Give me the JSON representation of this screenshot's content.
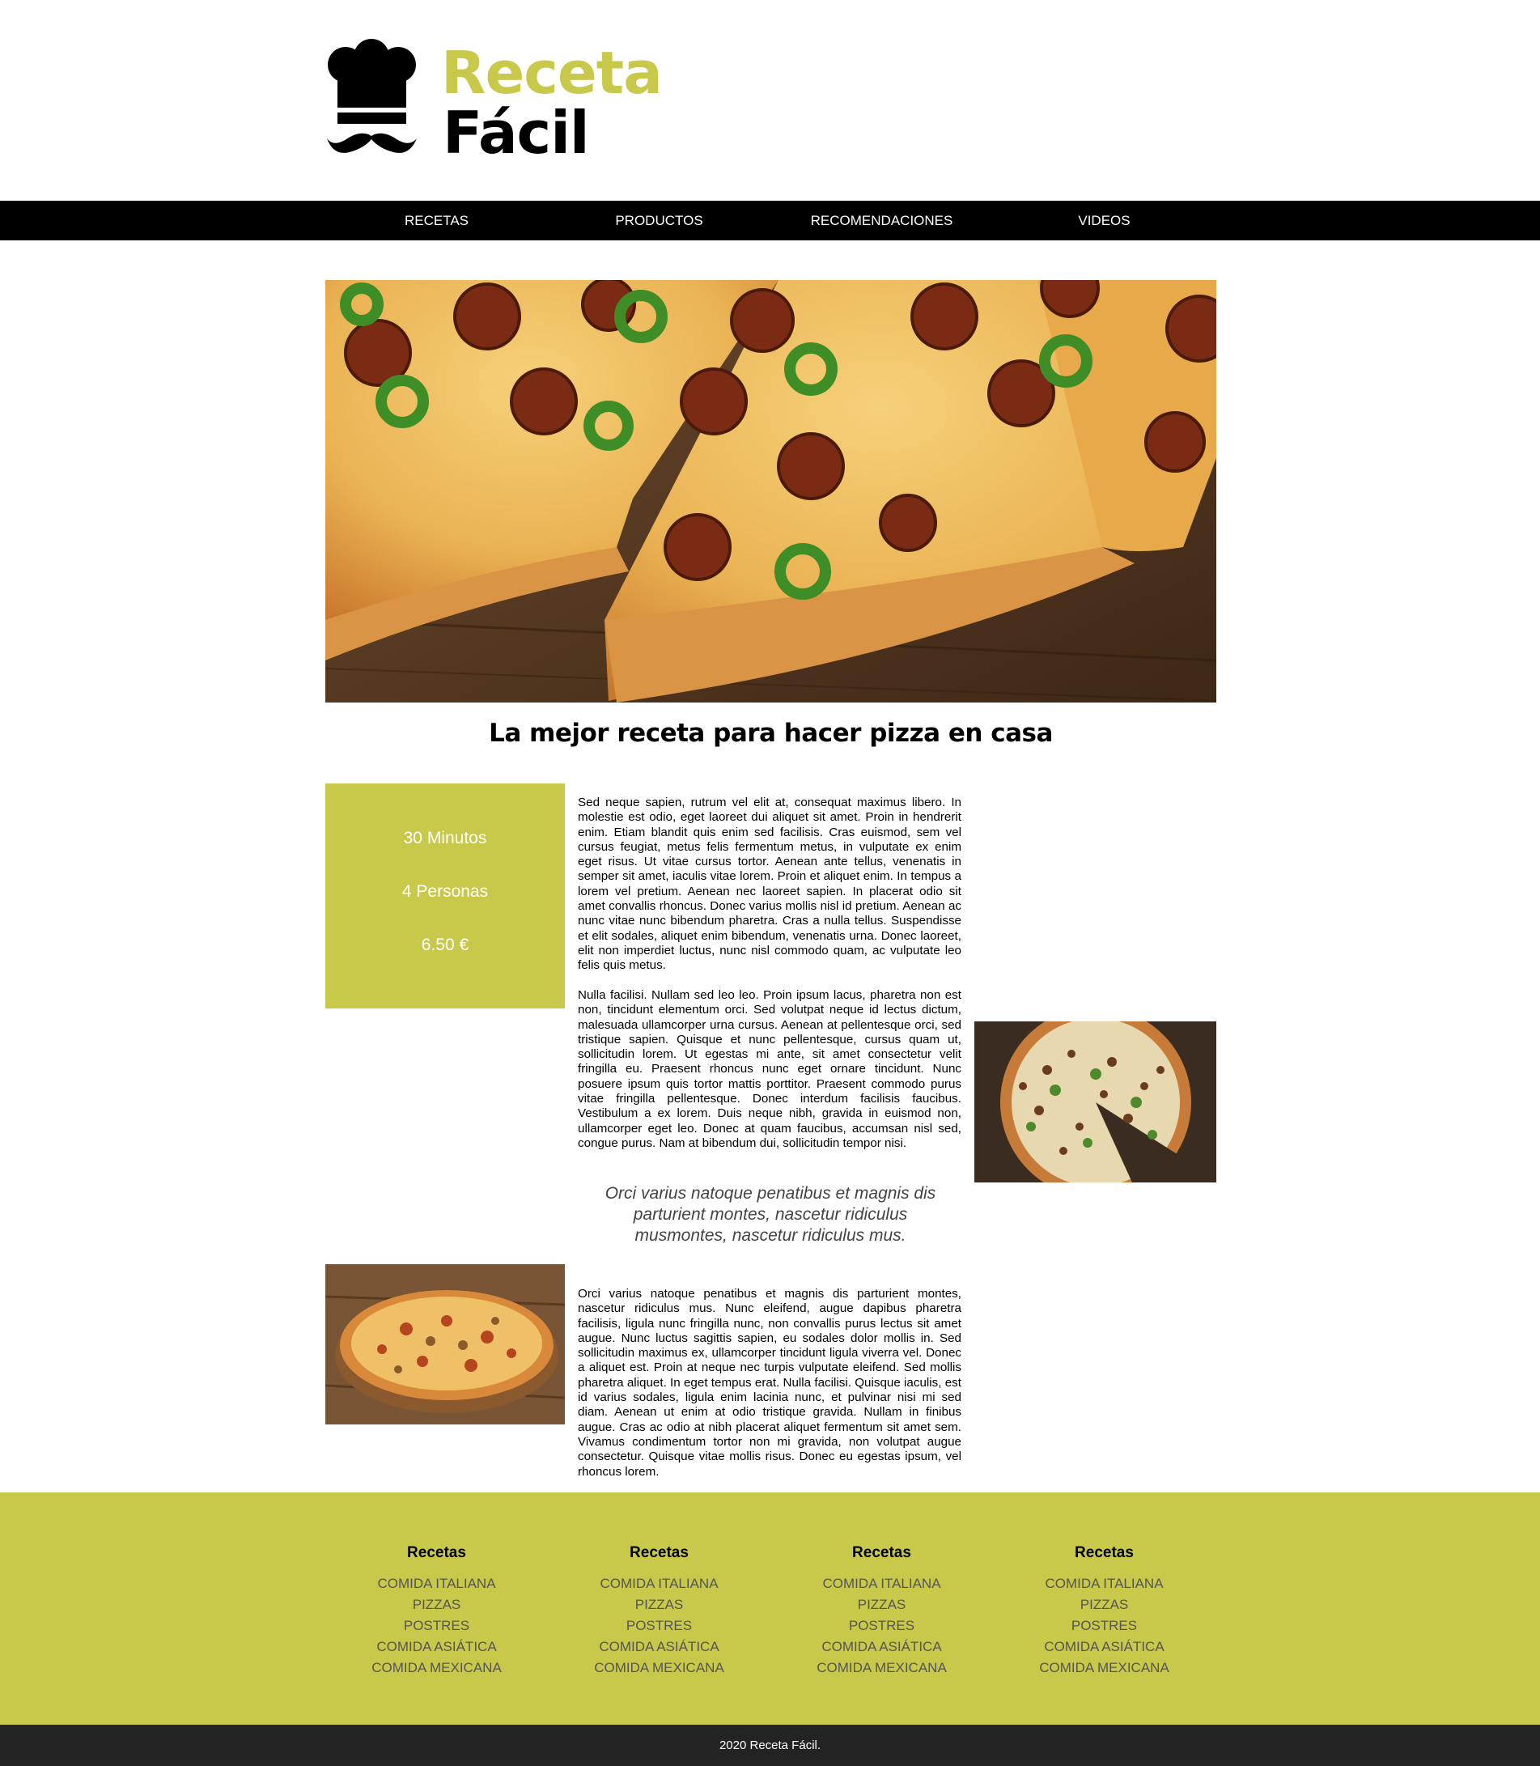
{
  "brand": {
    "line1": "Receta",
    "line2": "Fácil",
    "accent": "#c8c84a"
  },
  "nav": {
    "items": [
      "RECETAS",
      "PRODUCTOS",
      "RECOMENDACIONES",
      "VIDEOS"
    ]
  },
  "main": {
    "title": "La mejor receta para hacer pizza en casa",
    "info": {
      "time": "30 Minutos",
      "servings": "4 Personas",
      "price": "6.50 €"
    },
    "paragraph1": "Sed neque sapien, rutrum vel elit at, consequat maximus libero. In molestie est odio, eget laoreet dui aliquet sit amet. Proin in hendrerit enim. Etiam blandit quis enim sed facilisis. Cras euismod, sem vel cursus feugiat, metus felis fermentum metus, in vulputate ex enim eget risus. Ut vitae cursus tortor. Aenean ante tellus, venenatis in semper sit amet, iaculis vitae lorem. Proin et aliquet enim. In tempus a lorem vel pretium. Aenean nec laoreet sapien. In placerat odio sit amet convallis rhoncus. Donec varius mollis nisl id pretium. Aenean ac nunc vitae nunc bibendum pharetra. Cras a nulla tellus. Suspendisse et elit sodales, aliquet enim bibendum, venenatis urna. Donec laoreet, elit non imperdiet luctus, nunc nisl commodo quam, ac vulputate leo felis quis metus.",
    "paragraph2": "Nulla facilisi. Nullam sed leo leo. Proin ipsum lacus, pharetra non est non, tincidunt elementum orci. Sed volutpat neque id lectus dictum, malesuada ullamcorper urna cursus. Aenean at pellentesque orci, sed tristique sapien. Quisque et nunc pellentesque, cursus quam ut, sollicitudin lorem. Ut egestas mi ante, sit amet consectetur velit fringilla eu. Praesent rhoncus nunc eget ornare tincidunt. Nunc posuere ipsum quis tortor mattis porttitor. Praesent commodo purus vitae fringilla pellentesque. Donec interdum facilisis faucibus. Vestibulum a ex lorem. Duis neque nibh, gravida in euismod non, ullamcorper eget leo. Donec at quam faucibus, accumsan nisl sed, congue purus. Nam at bibendum dui, sollicitudin tempor nisi.",
    "quote": "Orci varius natoque penatibus et magnis dis parturient montes, nascetur ridiculus musmontes, nascetur ridiculus mus.",
    "paragraph3": "Orci varius natoque penatibus et magnis dis parturient montes, nascetur ridiculus mus. Nunc eleifend, augue dapibus pharetra facilisis, ligula nunc fringilla nunc, non convallis purus lectus sit amet augue. Nunc luctus sagittis sapien, eu sodales dolor mollis in. Sed sollicitudin maximus ex, ullamcorper tincidunt ligula viverra vel. Donec a aliquet est. Proin at neque nec turpis vulputate eleifend. Sed mollis pharetra aliquet. In eget tempus erat. Nulla facilisi. Quisque iaculis, est id varius sodales, ligula enim lacinia nunc, et pulvinar nisi mi sed diam. Aenean ut enim at odio tristique gravida. Nullam in finibus augue. Cras ac odio at nibh placerat aliquet fermentum sit amet sem. Vivamus condimentum tortor non mi gravida, non volutpat augue consectetur. Quisque vitae mollis risus. Donec eu egestas ipsum, vel rhoncus lorem."
  },
  "footer": {
    "columns": [
      {
        "heading": "Recetas",
        "links": [
          "COMIDA ITALIANA",
          "PIZZAS",
          "POSTRES",
          "COMIDA ASIÁTICA",
          "COMIDA MEXICANA"
        ]
      },
      {
        "heading": "Recetas",
        "links": [
          "COMIDA ITALIANA",
          "PIZZAS",
          "POSTRES",
          "COMIDA ASIÁTICA",
          "COMIDA MEXICANA"
        ]
      },
      {
        "heading": "Recetas",
        "links": [
          "COMIDA ITALIANA",
          "PIZZAS",
          "POSTRES",
          "COMIDA ASIÁTICA",
          "COMIDA MEXICANA"
        ]
      },
      {
        "heading": "Recetas",
        "links": [
          "COMIDA ITALIANA",
          "PIZZAS",
          "POSTRES",
          "COMIDA ASIÁTICA",
          "COMIDA MEXICANA"
        ]
      }
    ],
    "copyright": "2020 Receta Fácil."
  }
}
